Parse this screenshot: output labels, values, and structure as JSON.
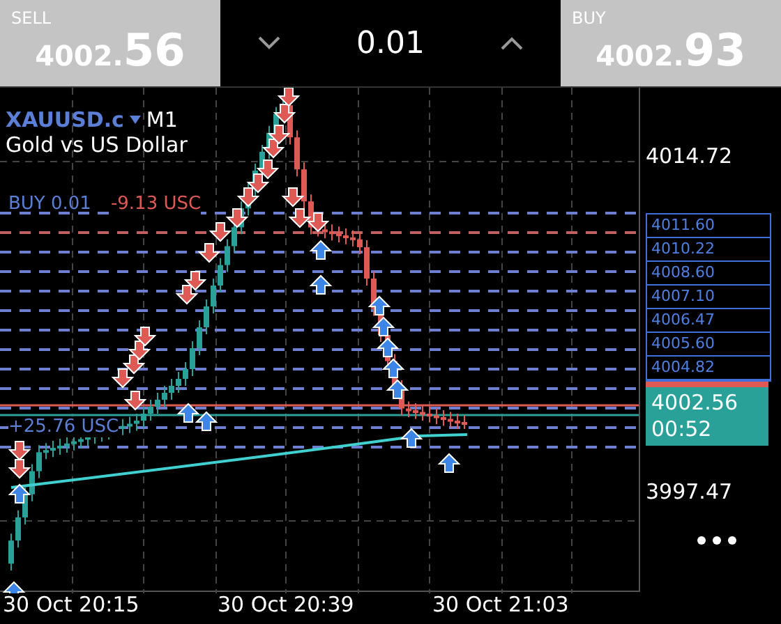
{
  "quote_bar": {
    "sell": {
      "label": "SELL",
      "price_head": "4002.",
      "price_tail": "56"
    },
    "lot": {
      "value": "0.01"
    },
    "buy": {
      "label": "BUY",
      "price_head": "4002.",
      "price_tail": "93"
    }
  },
  "chart": {
    "symbol": "XAUUSD.c",
    "timeframe": "M1",
    "description": "Gold vs US Dollar",
    "order_labels": [
      {
        "volume": "BUY 0.01",
        "profit": "-9.13 USC",
        "color": "#e05a55"
      },
      {
        "profit": "+25.76 USC",
        "color": "#5b7fd6"
      }
    ],
    "price_axis": [
      "4014.72",
      "3997.47"
    ],
    "order_tags": [
      "4011.60",
      "4010.22",
      "4008.60",
      "4007.10",
      "4006.47",
      "4005.60",
      "4004.82"
    ],
    "current_price": {
      "price": "4002.56",
      "countdown": "00:52"
    },
    "time_axis": [
      "30 Oct 20:15",
      "30 Oct 20:39",
      "30 Oct 21:03"
    ]
  }
}
